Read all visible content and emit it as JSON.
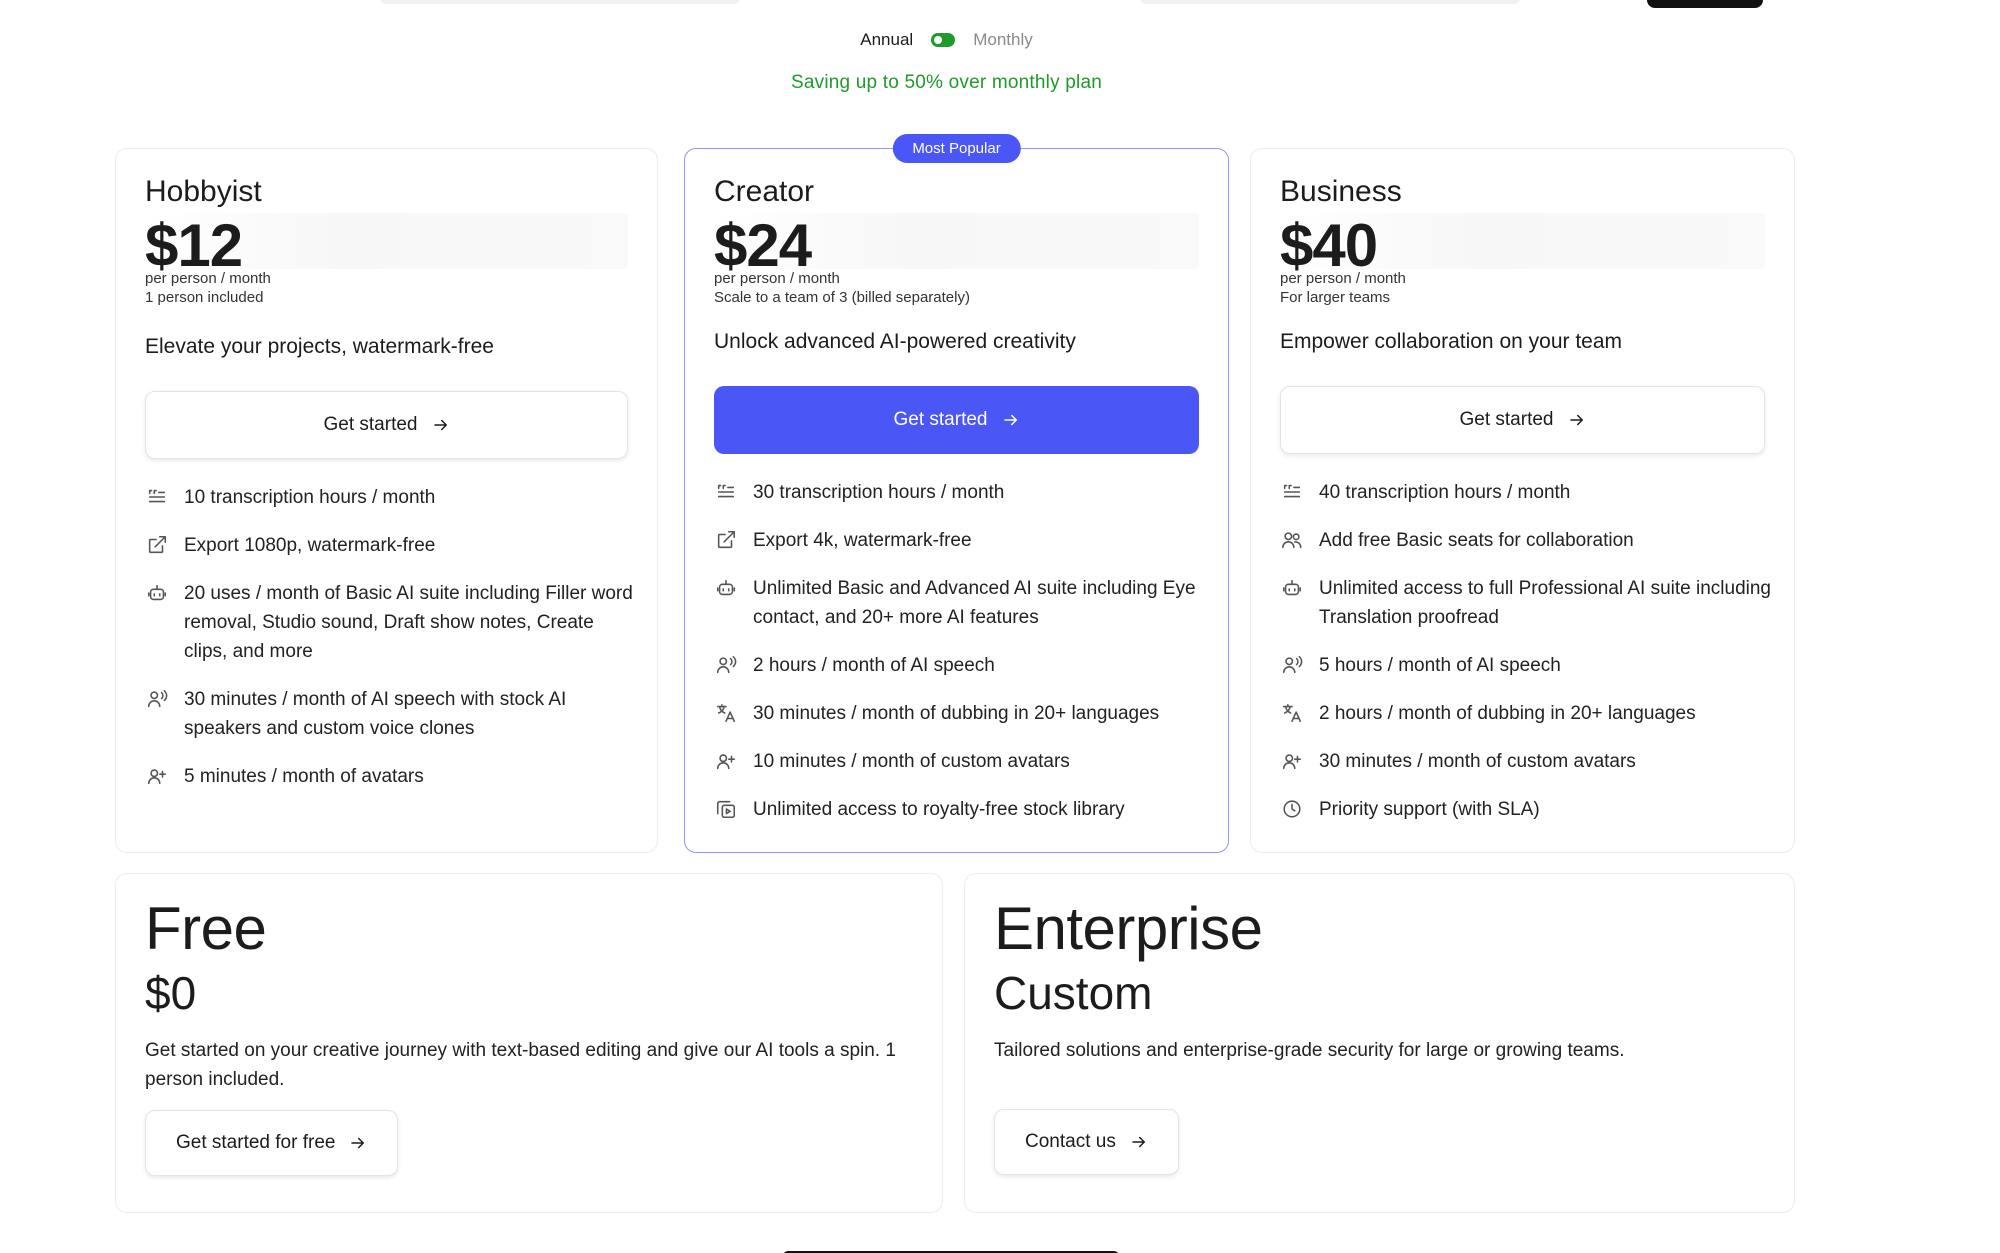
{
  "billing": {
    "annual_label": "Annual",
    "monthly_label": "Monthly",
    "saving_text": "Saving up to 50% over monthly plan"
  },
  "plans": [
    {
      "name": "Hobbyist",
      "price": "$12",
      "per": "per person / month",
      "sub": "1 person included",
      "tagline": "Elevate your projects, watermark-free",
      "cta": "Get started",
      "features": [
        {
          "icon": "transcript-icon",
          "text": "10 transcription hours / month"
        },
        {
          "icon": "export-icon",
          "text": "Export 1080p, watermark-free"
        },
        {
          "icon": "robot-icon",
          "text": "20 uses / month of Basic AI suite including Filler word removal, Studio sound, Draft show notes, Create clips, and more"
        },
        {
          "icon": "speaker-icon",
          "text": "30 minutes / month of AI speech with stock AI speakers and custom voice clones"
        },
        {
          "icon": "avatar-sparkle-icon",
          "text": "5 minutes / month of avatars"
        }
      ]
    },
    {
      "name": "Creator",
      "badge": "Most Popular",
      "price": "$24",
      "per": "per person / month",
      "sub": "Scale to a team of 3 (billed separately)",
      "tagline": "Unlock advanced AI-powered creativity",
      "cta": "Get started",
      "features": [
        {
          "icon": "transcript-icon",
          "text": "30 transcription hours / month"
        },
        {
          "icon": "export-icon",
          "text": "Export 4k, watermark-free"
        },
        {
          "icon": "robot-icon",
          "text": "Unlimited Basic and Advanced AI suite including Eye contact, and 20+ more AI features"
        },
        {
          "icon": "speaker-icon",
          "text": "2 hours / month of AI speech"
        },
        {
          "icon": "translate-icon",
          "text": "30 minutes / month of dubbing in 20+ languages"
        },
        {
          "icon": "avatar-sparkle-icon",
          "text": "10 minutes / month of custom avatars"
        },
        {
          "icon": "media-library-icon",
          "text": "Unlimited access to royalty-free stock library"
        }
      ]
    },
    {
      "name": "Business",
      "price": "$40",
      "per": "per person / month",
      "sub": "For larger teams",
      "tagline": "Empower collaboration on your team",
      "cta": "Get started",
      "features": [
        {
          "icon": "transcript-icon",
          "text": "40 transcription hours / month"
        },
        {
          "icon": "users-icon",
          "text": "Add free Basic seats for collaboration"
        },
        {
          "icon": "robot-icon",
          "text": "Unlimited access to full Professional AI suite including Translation proofread"
        },
        {
          "icon": "speaker-icon",
          "text": "5 hours / month of AI speech"
        },
        {
          "icon": "translate-icon",
          "text": "2 hours / month of dubbing in 20+ languages"
        },
        {
          "icon": "avatar-sparkle-icon",
          "text": "30 minutes / month of custom avatars"
        },
        {
          "icon": "clock-icon",
          "text": "Priority support (with SLA)"
        }
      ]
    }
  ],
  "free": {
    "name": "Free",
    "price": "$0",
    "desc": "Get started on your creative journey with text-based editing and give our AI tools a spin. 1 person included.",
    "cta": "Get started for free"
  },
  "enterprise": {
    "name": "Enterprise",
    "price": "Custom",
    "desc": "Tailored solutions and enterprise-grade security for large or growing teams.",
    "cta": "Contact us"
  }
}
